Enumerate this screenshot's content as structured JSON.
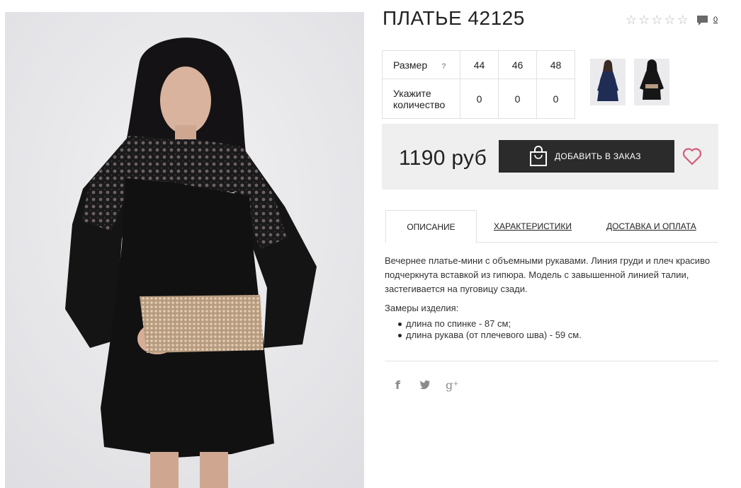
{
  "product": {
    "title": "ПЛАТЬЕ 42125",
    "comment_count": "0",
    "rating_stars": [
      "☆",
      "☆",
      "☆",
      "☆",
      "☆"
    ]
  },
  "sizes": {
    "size_label": "Размер",
    "help": "?",
    "qty_label": "Укажите количество",
    "columns": [
      {
        "size": "44",
        "qty": "0"
      },
      {
        "size": "46",
        "qty": "0"
      },
      {
        "size": "48",
        "qty": "0"
      }
    ]
  },
  "price": {
    "value": "1190 руб",
    "order_button": "ДОБАВИТЬ В ЗАКАЗ"
  },
  "tabs": [
    {
      "label": "ОПИСАНИЕ",
      "active": true
    },
    {
      "label": "ХАРАКТЕРИСТИКИ",
      "active": false
    },
    {
      "label": "ДОСТАВКА И ОПЛАТА",
      "active": false
    }
  ],
  "description": {
    "text": "Вечернее платье-мини с объемными рукавами. Линия груди и плеч красиво подчеркнута вставкой из гипюра. Модель с завышенной линией талии, застегивается на пуговицу сзади.",
    "measures_title": "Замеры изделия:",
    "measures": [
      "длина по спинке - 87 см;",
      "длина рукава (от плечевого шва) - 59 см."
    ]
  },
  "social": {
    "facebook": "f",
    "twitter": "🐦",
    "google_plus": "g⁺"
  },
  "colors": {
    "button_bg": "#2b2b2b",
    "price_box_bg": "#efefef",
    "heart": "#d65b7a"
  },
  "icons": [
    "star-icon",
    "comment-icon",
    "bag-icon",
    "heart-icon",
    "facebook-icon",
    "twitter-icon",
    "google-plus-icon"
  ]
}
